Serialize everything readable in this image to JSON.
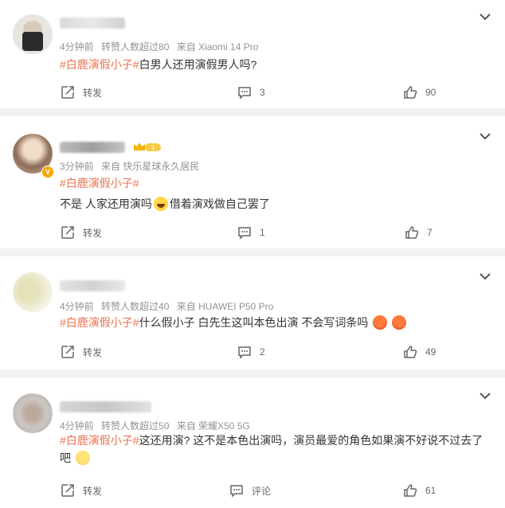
{
  "labels": {
    "repost": "转发",
    "comment": "评论"
  },
  "colors": {
    "tag": "#eb7350",
    "meta": "#939393",
    "separator": "#f2f2f2"
  },
  "posts": [
    {
      "meta": {
        "time": "4分钟前",
        "reposts": "转赞人数超过80",
        "source": "来自 Xiaomi 14 Pro"
      },
      "tag": "#白鹿演假小子#",
      "text": "白男人还用演假男人吗?",
      "comments": "3",
      "likes": "90"
    },
    {
      "meta": {
        "time": "3分钟前",
        "reposts": "",
        "source": "来自 快乐星球永久居民"
      },
      "tag": "#白鹿演假小子#",
      "text_a": "不是 人家还用演吗",
      "text_b": "借着演戏做自己罢了",
      "comments": "1",
      "likes": "7"
    },
    {
      "meta": {
        "time": "4分钟前",
        "reposts": "转赞人数超过40",
        "source": "来自 HUAWEI P50 Pro"
      },
      "tag": "#白鹿演假小子#",
      "text": "什么假小子 白先生这叫本色出演 不会写词条吗",
      "comments": "2",
      "likes": "49"
    },
    {
      "meta": {
        "time": "4分钟前",
        "reposts": "转赞人数超过50",
        "source": "来自 荣耀X50 5G"
      },
      "tag": "#白鹿演假小子#",
      "text_line1": "这还用演? 这不是本色出演吗，演员最爱的角色如果演不好说不过去了",
      "text_line2": "吧",
      "likes": "61"
    }
  ]
}
